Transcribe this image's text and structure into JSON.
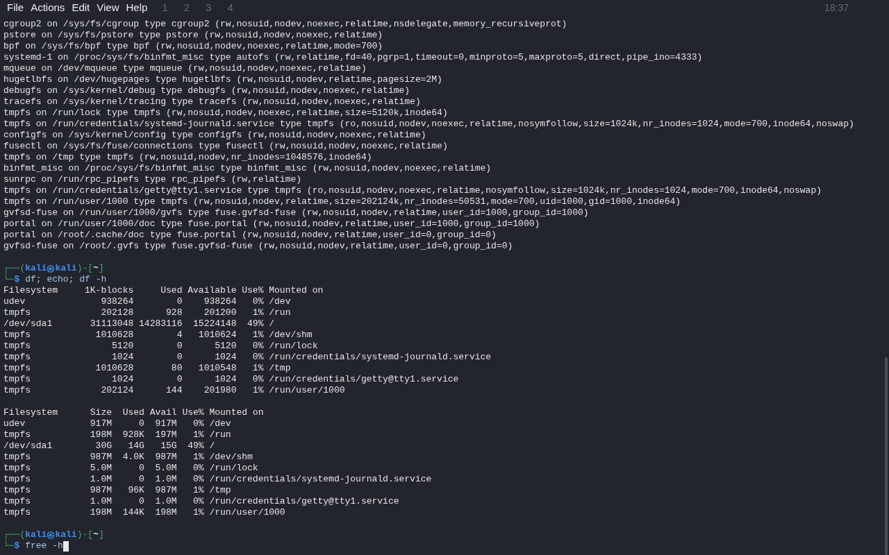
{
  "menu": [
    "File",
    "Actions",
    "Edit",
    "View",
    "Help"
  ],
  "panel": {
    "workspaces": [
      "1",
      "2",
      "3",
      "4"
    ],
    "clock": "18:37"
  },
  "lines": [
    {
      "kind": "output",
      "text": "cgroup2 on /sys/fs/cgroup type cgroup2 (rw,nosuid,nodev,noexec,relatime,nsdelegate,memory_recursiveprot)"
    },
    {
      "kind": "output",
      "text": "pstore on /sys/fs/pstore type pstore (rw,nosuid,nodev,noexec,relatime)"
    },
    {
      "kind": "output",
      "text": "bpf on /sys/fs/bpf type bpf (rw,nosuid,nodev,noexec,relatime,mode=700)"
    },
    {
      "kind": "output",
      "text": "systemd-1 on /proc/sys/fs/binfmt_misc type autofs (rw,relatime,fd=40,pgrp=1,timeout=0,minproto=5,maxproto=5,direct,pipe_ino=4333)"
    },
    {
      "kind": "output",
      "text": "mqueue on /dev/mqueue type mqueue (rw,nosuid,nodev,noexec,relatime)"
    },
    {
      "kind": "output",
      "text": "hugetlbfs on /dev/hugepages type hugetlbfs (rw,nosuid,nodev,relatime,pagesize=2M)"
    },
    {
      "kind": "output",
      "text": "debugfs on /sys/kernel/debug type debugfs (rw,nosuid,nodev,noexec,relatime)"
    },
    {
      "kind": "output",
      "text": "tracefs on /sys/kernel/tracing type tracefs (rw,nosuid,nodev,noexec,relatime)"
    },
    {
      "kind": "output",
      "text": "tmpfs on /run/lock type tmpfs (rw,nosuid,nodev,noexec,relatime,size=5120k,inode64)"
    },
    {
      "kind": "output",
      "text": "tmpfs on /run/credentials/systemd-journald.service type tmpfs (ro,nosuid,nodev,noexec,relatime,nosymfollow,size=1024k,nr_inodes=1024,mode=700,inode64,noswap)"
    },
    {
      "kind": "output",
      "text": "configfs on /sys/kernel/config type configfs (rw,nosuid,nodev,noexec,relatime)"
    },
    {
      "kind": "output",
      "text": "fusectl on /sys/fs/fuse/connections type fusectl (rw,nosuid,nodev,noexec,relatime)"
    },
    {
      "kind": "output",
      "text": "tmpfs on /tmp type tmpfs (rw,nosuid,nodev,nr_inodes=1048576,inode64)"
    },
    {
      "kind": "output",
      "text": "binfmt_misc on /proc/sys/fs/binfmt_misc type binfmt_misc (rw,nosuid,nodev,noexec,relatime)"
    },
    {
      "kind": "output",
      "text": "sunrpc on /run/rpc_pipefs type rpc_pipefs (rw,relatime)"
    },
    {
      "kind": "output",
      "text": "tmpfs on /run/credentials/getty@tty1.service type tmpfs (ro,nosuid,nodev,noexec,relatime,nosymfollow,size=1024k,nr_inodes=1024,mode=700,inode64,noswap)"
    },
    {
      "kind": "output",
      "text": "tmpfs on /run/user/1000 type tmpfs (rw,nosuid,nodev,relatime,size=202124k,nr_inodes=50531,mode=700,uid=1000,gid=1000,inode64)"
    },
    {
      "kind": "output",
      "text": "gvfsd-fuse on /run/user/1000/gvfs type fuse.gvfsd-fuse (rw,nosuid,nodev,relatime,user_id=1000,group_id=1000)"
    },
    {
      "kind": "output",
      "text": "portal on /run/user/1000/doc type fuse.portal (rw,nosuid,nodev,relatime,user_id=1000,group_id=1000)"
    },
    {
      "kind": "output",
      "text": "portal on /root/.cache/doc type fuse.portal (rw,nosuid,nodev,relatime,user_id=0,group_id=0)"
    },
    {
      "kind": "output",
      "text": "gvfsd-fuse on /root/.gvfs type fuse.gvfsd-fuse (rw,nosuid,nodev,relatime,user_id=0,group_id=0)"
    },
    {
      "kind": "blank"
    },
    {
      "kind": "prompt",
      "open": "┌──(",
      "user": "kali",
      "at": "㉿",
      "host": "kali",
      "mid": ")-[",
      "dir": "~",
      "close": "]",
      "corner": "└─",
      "sigil": "$",
      "command": "df; echo; df -h",
      "cursor": false
    },
    {
      "kind": "output",
      "text": "Filesystem     1K-blocks     Used Available Use% Mounted on"
    },
    {
      "kind": "output",
      "text": "udev              938264        0    938264   0% /dev"
    },
    {
      "kind": "output",
      "text": "tmpfs             202128      928    201200   1% /run"
    },
    {
      "kind": "output",
      "text": "/dev/sda1       31113048 14283116  15224148  49% /"
    },
    {
      "kind": "output",
      "text": "tmpfs            1010628        4   1010624   1% /dev/shm"
    },
    {
      "kind": "output",
      "text": "tmpfs               5120        0      5120   0% /run/lock"
    },
    {
      "kind": "output",
      "text": "tmpfs               1024        0      1024   0% /run/credentials/systemd-journald.service"
    },
    {
      "kind": "output",
      "text": "tmpfs            1010628       80   1010548   1% /tmp"
    },
    {
      "kind": "output",
      "text": "tmpfs               1024        0      1024   0% /run/credentials/getty@tty1.service"
    },
    {
      "kind": "output",
      "text": "tmpfs             202124      144    201980   1% /run/user/1000"
    },
    {
      "kind": "blank"
    },
    {
      "kind": "output",
      "text": "Filesystem      Size  Used Avail Use% Mounted on"
    },
    {
      "kind": "output",
      "text": "udev            917M     0  917M   0% /dev"
    },
    {
      "kind": "output",
      "text": "tmpfs           198M  928K  197M   1% /run"
    },
    {
      "kind": "output",
      "text": "/dev/sda1        30G   14G   15G  49% /"
    },
    {
      "kind": "output",
      "text": "tmpfs           987M  4.0K  987M   1% /dev/shm"
    },
    {
      "kind": "output",
      "text": "tmpfs           5.0M     0  5.0M   0% /run/lock"
    },
    {
      "kind": "output",
      "text": "tmpfs           1.0M     0  1.0M   0% /run/credentials/systemd-journald.service"
    },
    {
      "kind": "output",
      "text": "tmpfs           987M   96K  987M   1% /tmp"
    },
    {
      "kind": "output",
      "text": "tmpfs           1.0M     0  1.0M   0% /run/credentials/getty@tty1.service"
    },
    {
      "kind": "output",
      "text": "tmpfs           198M  144K  198M   1% /run/user/1000"
    },
    {
      "kind": "blank"
    },
    {
      "kind": "prompt",
      "open": "┌──(",
      "user": "kali",
      "at": "㉿",
      "host": "kali",
      "mid": ")-[",
      "dir": "~",
      "close": "]",
      "corner": "└─",
      "sigil": "$",
      "command": "free -h",
      "cursor": true
    }
  ]
}
